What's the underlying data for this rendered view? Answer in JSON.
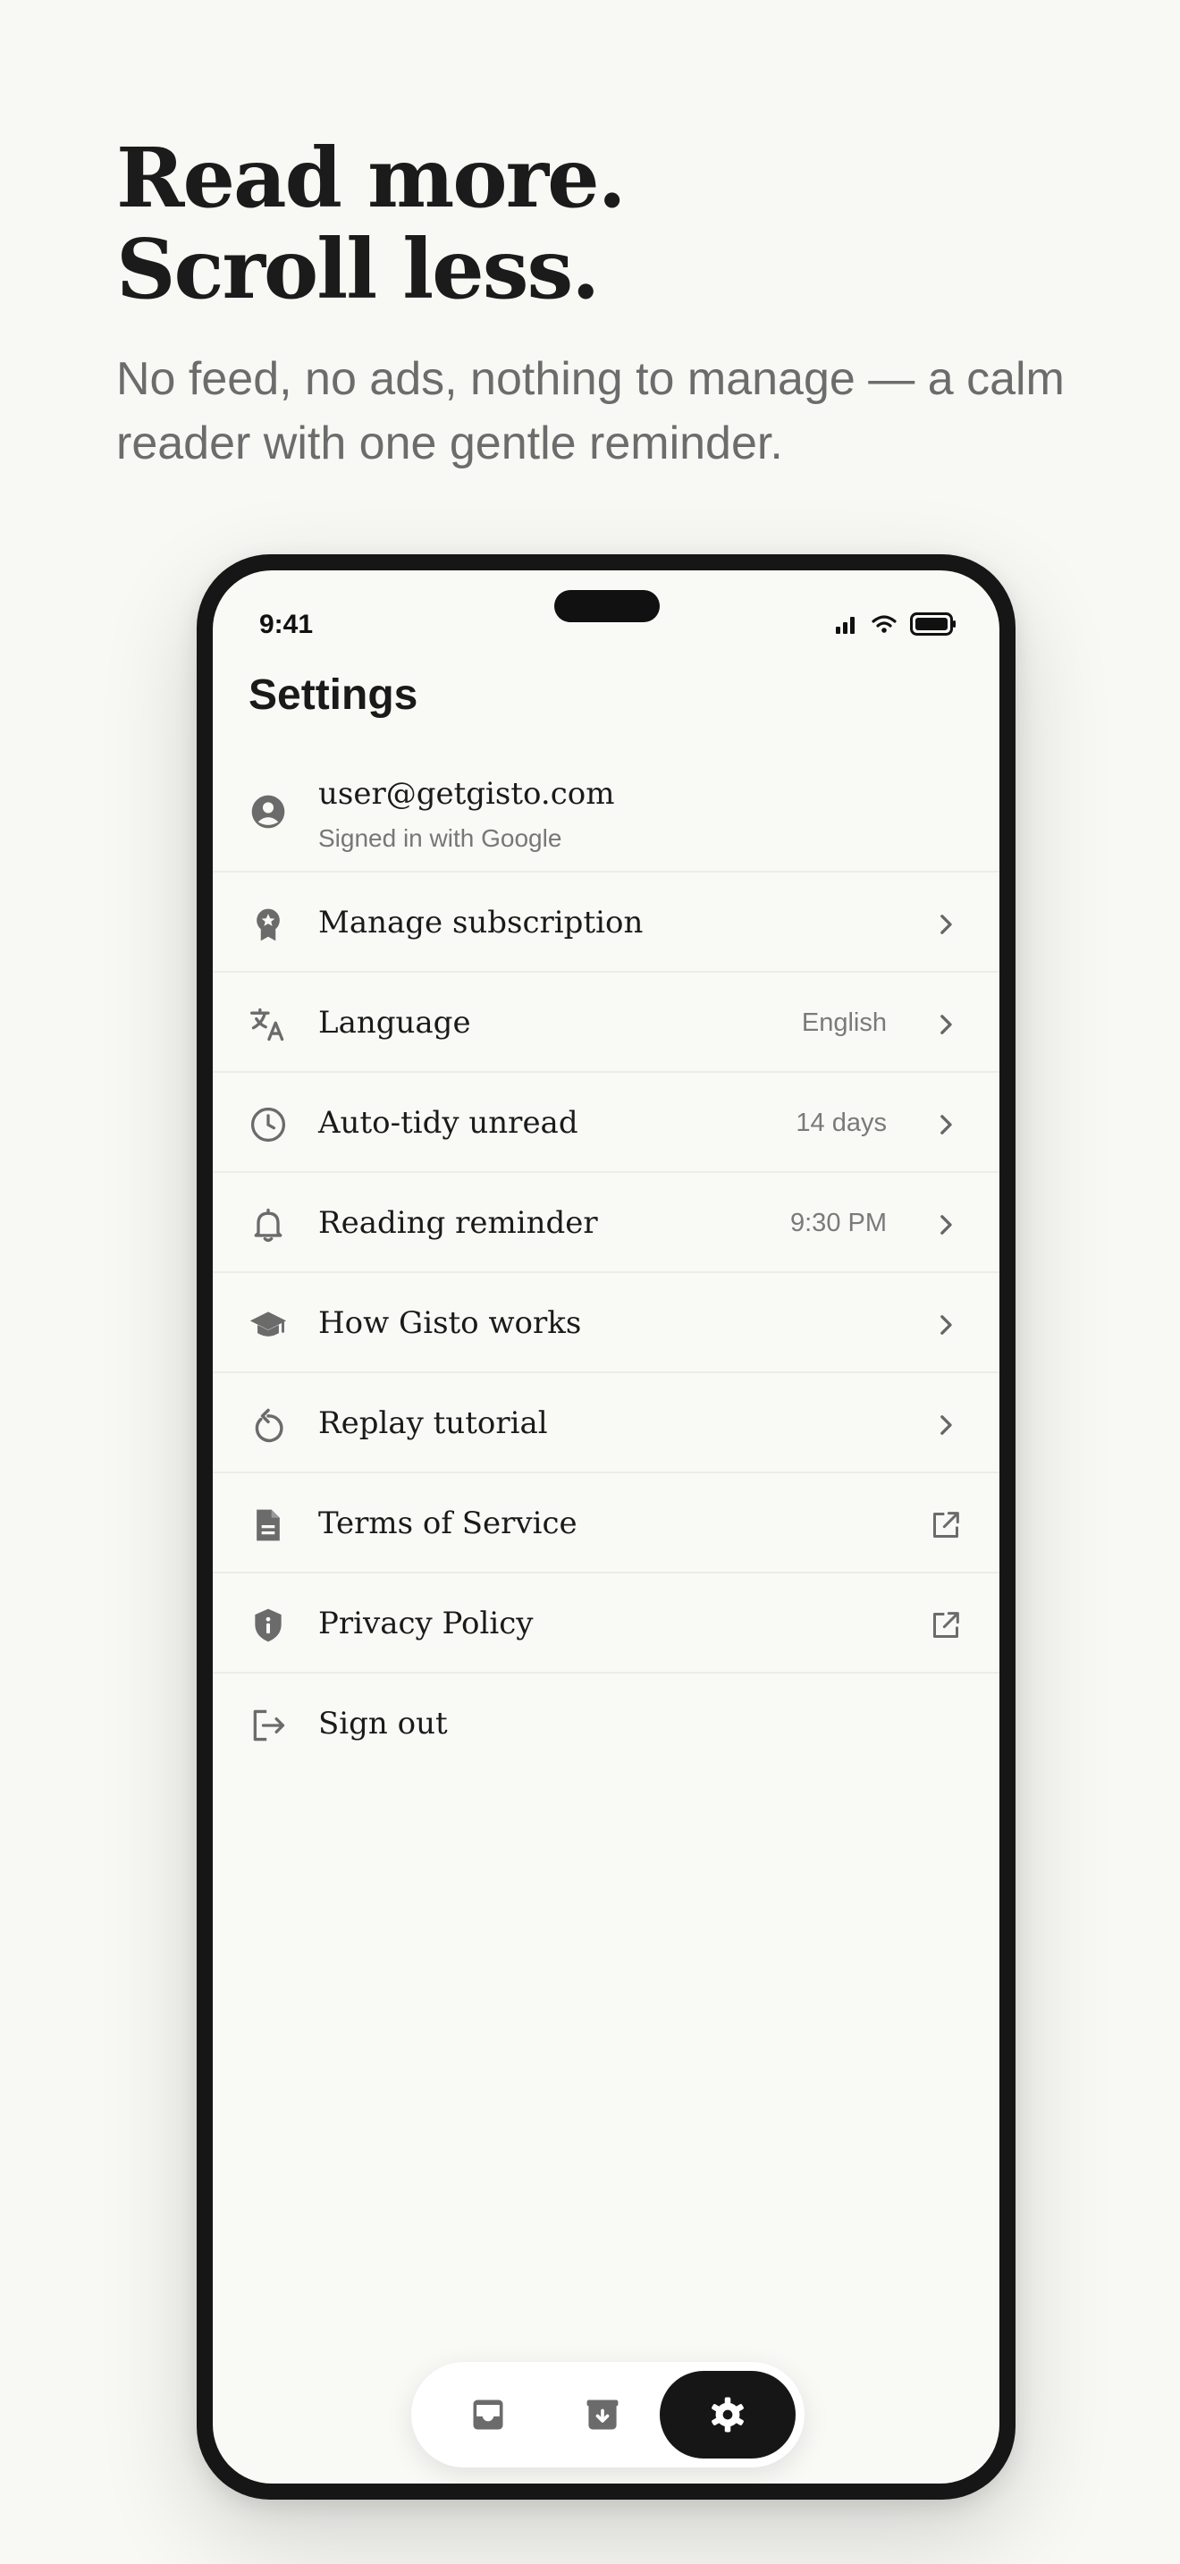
{
  "hero": {
    "headline_line1": "Read more.",
    "headline_line2": "Scroll less.",
    "subhead": "No feed, no ads, nothing to manage — a calm reader with one gentle reminder."
  },
  "status_bar": {
    "time": "9:41",
    "icons": [
      "cellular-signal-icon",
      "wifi-icon",
      "battery-icon"
    ]
  },
  "settings": {
    "title": "Settings",
    "account": {
      "email": "user@getgisto.com",
      "provider_text": "Signed in with Google",
      "icon": "account-circle-icon"
    },
    "items": [
      {
        "label": "Manage subscription",
        "value": "",
        "icon": "badge-icon",
        "trailing": "chevron-right-icon"
      },
      {
        "label": "Language",
        "value": "English",
        "icon": "translate-icon",
        "trailing": "chevron-right-icon"
      },
      {
        "label": "Auto-tidy unread",
        "value": "14 days",
        "icon": "clock-icon",
        "trailing": "chevron-right-icon"
      },
      {
        "label": "Reading reminder",
        "value": "9:30 PM",
        "icon": "bell-icon",
        "trailing": "chevron-right-icon"
      },
      {
        "label": "How Gisto works",
        "value": "",
        "icon": "graduation-cap-icon",
        "trailing": "chevron-right-icon"
      },
      {
        "label": "Replay tutorial",
        "value": "",
        "icon": "replay-icon",
        "trailing": "chevron-right-icon"
      },
      {
        "label": "Terms of Service",
        "value": "",
        "icon": "document-icon",
        "trailing": "external-link-icon"
      },
      {
        "label": "Privacy Policy",
        "value": "",
        "icon": "shield-info-icon",
        "trailing": "external-link-icon"
      },
      {
        "label": "Sign out",
        "value": "",
        "icon": "logout-icon",
        "trailing": ""
      }
    ]
  },
  "tab_bar": {
    "tabs": [
      {
        "id": "inbox",
        "icon": "inbox-icon",
        "active": false
      },
      {
        "id": "archive",
        "icon": "archive-icon",
        "active": false
      },
      {
        "id": "settings",
        "icon": "gear-icon",
        "active": true
      }
    ]
  },
  "colors": {
    "background": "#f8f8f4",
    "text_primary": "#1a1a1a",
    "text_secondary": "#777777",
    "icon": "#666666",
    "active_tab": "#161616"
  }
}
